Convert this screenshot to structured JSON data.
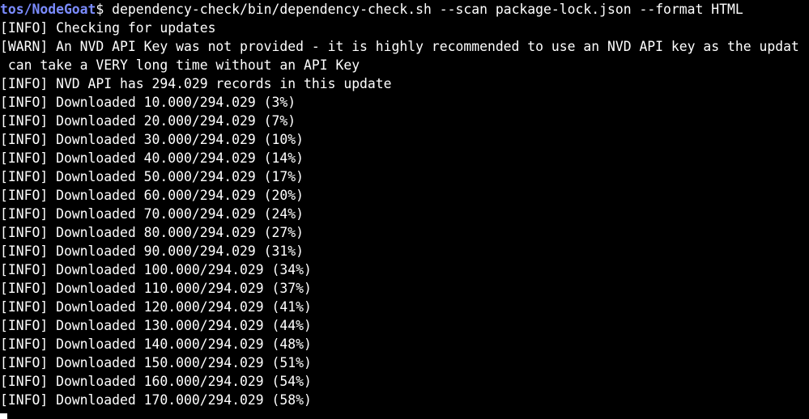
{
  "terminal": {
    "prompt_path": "tos/NodeGoat",
    "prompt_symbol": "$",
    "command": " dependency-check/bin/dependency-check.sh --scan package-lock.json --format HTML",
    "colors": {
      "background": "#000000",
      "text": "#ffffff",
      "prompt_path": "#7b8cff"
    },
    "output_lines": [
      "[INFO] Checking for updates",
      "[WARN] An NVD API Key was not provided - it is highly recommended to use an NVD API key as the updat",
      " can take a VERY long time without an API Key",
      "[INFO] NVD API has 294.029 records in this update",
      "[INFO] Downloaded 10.000/294.029 (3%)",
      "[INFO] Downloaded 20.000/294.029 (7%)",
      "[INFO] Downloaded 30.000/294.029 (10%)",
      "[INFO] Downloaded 40.000/294.029 (14%)",
      "[INFO] Downloaded 50.000/294.029 (17%)",
      "[INFO] Downloaded 60.000/294.029 (20%)",
      "[INFO] Downloaded 70.000/294.029 (24%)",
      "[INFO] Downloaded 80.000/294.029 (27%)",
      "[INFO] Downloaded 90.000/294.029 (31%)",
      "[INFO] Downloaded 100.000/294.029 (34%)",
      "[INFO] Downloaded 110.000/294.029 (37%)",
      "[INFO] Downloaded 120.000/294.029 (41%)",
      "[INFO] Downloaded 130.000/294.029 (44%)",
      "[INFO] Downloaded 140.000/294.029 (48%)",
      "[INFO] Downloaded 150.000/294.029 (51%)",
      "[INFO] Downloaded 160.000/294.029 (54%)",
      "[INFO] Downloaded 170.000/294.029 (58%)"
    ]
  }
}
